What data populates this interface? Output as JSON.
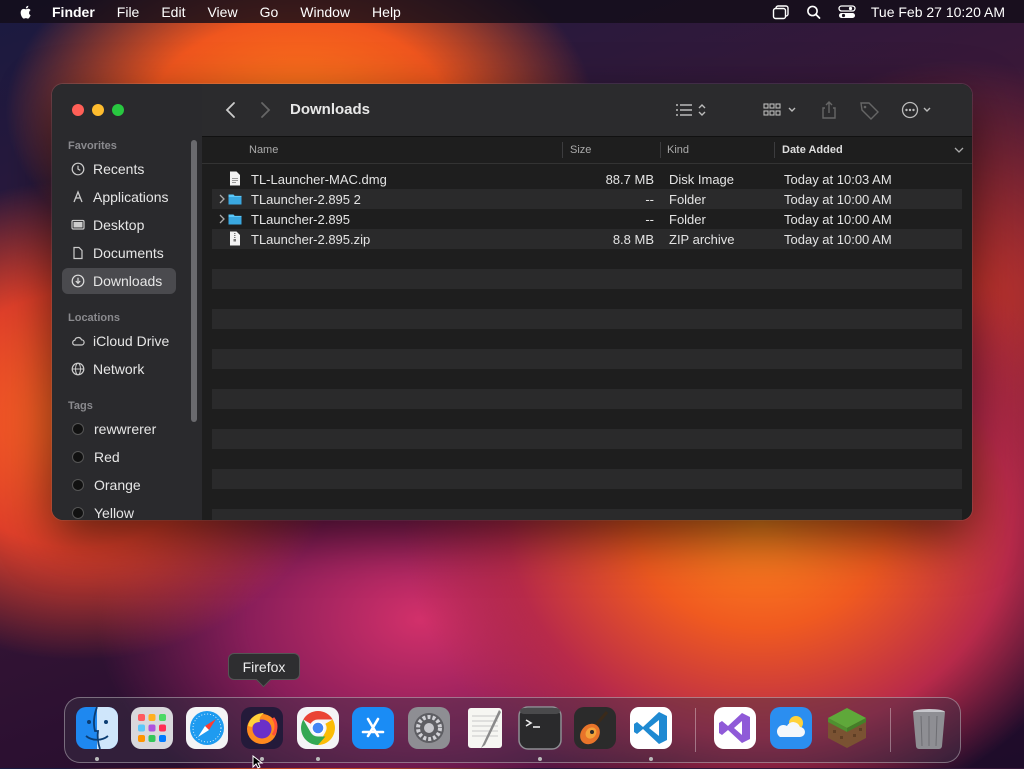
{
  "menubar": {
    "app_name": "Finder",
    "menus": [
      "File",
      "Edit",
      "View",
      "Go",
      "Window",
      "Help"
    ],
    "clock": "Tue Feb 27  10:20 AM"
  },
  "window": {
    "title": "Downloads",
    "sidebar": {
      "favorites_title": "Favorites",
      "favorites": [
        "Recents",
        "Applications",
        "Desktop",
        "Documents",
        "Downloads"
      ],
      "locations_title": "Locations",
      "locations": [
        "iCloud Drive",
        "Network"
      ],
      "tags_title": "Tags",
      "tags": [
        "rewwrerer",
        "Red",
        "Orange",
        "Yellow"
      ],
      "active_item": "Downloads"
    },
    "columns": {
      "name": "Name",
      "size": "Size",
      "kind": "Kind",
      "date": "Date Added"
    },
    "files": [
      {
        "name": "TL-Launcher-MAC.dmg",
        "size": "88.7 MB",
        "kind": "Disk Image",
        "date": "Today at 10:03 AM",
        "icon": "document-icon",
        "folder": false
      },
      {
        "name": "TLauncher-2.895 2",
        "size": "--",
        "kind": "Folder",
        "date": "Today at 10:00 AM",
        "icon": "folder-icon",
        "folder": true
      },
      {
        "name": "TLauncher-2.895",
        "size": "--",
        "kind": "Folder",
        "date": "Today at 10:00 AM",
        "icon": "folder-icon",
        "folder": true
      },
      {
        "name": "TLauncher-2.895.zip",
        "size": "8.8 MB",
        "kind": "ZIP archive",
        "date": "Today at 10:00 AM",
        "icon": "zip-icon",
        "folder": false
      }
    ]
  },
  "dock": {
    "tooltip": "Firefox",
    "apps": [
      "Finder",
      "Launchpad",
      "Safari",
      "Firefox",
      "Chrome",
      "App Store",
      "System Settings",
      "TextEdit",
      "Terminal",
      "GarageBand",
      "Visual Studio Code",
      "Visual Studio",
      "Weather",
      "Minecraft",
      "Trash"
    ]
  },
  "colors": {
    "accent": "#0a84ff",
    "close": "#ff5f57",
    "minimize": "#febc2e",
    "zoom": "#28c840",
    "folder": "#5ac8fa"
  }
}
